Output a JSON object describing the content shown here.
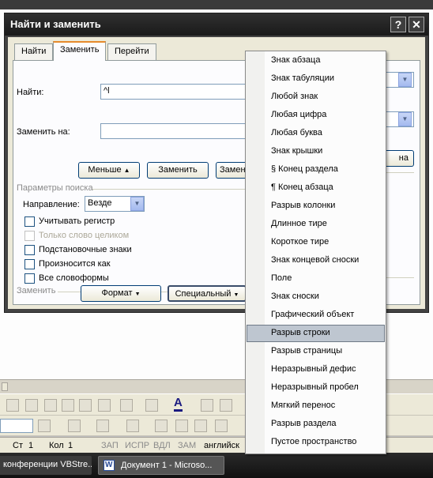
{
  "dialog": {
    "title": "Найти и заменить",
    "help_button": "?",
    "close_button": "✕",
    "tabs": [
      {
        "label": "Найти",
        "active": false
      },
      {
        "label": "Заменить",
        "active": true
      },
      {
        "label": "Перейти",
        "active": false
      }
    ],
    "find_label": "Найти:",
    "find_value": "^l",
    "replace_label": "Заменить на:",
    "replace_value": "",
    "less_button": "Меньше",
    "replace_button": "Заменить",
    "replace_all_button_partial": "Замени",
    "cancel_button_partial": "на",
    "search_params_label": "Параметры поиска",
    "direction_label": "Направление:",
    "direction_value": "Везде",
    "checkboxes": [
      {
        "label": "Учитывать регистр",
        "checked": false,
        "enabled": true
      },
      {
        "label": "Только слово целиком",
        "checked": false,
        "enabled": false
      },
      {
        "label": "Подстановочные знаки",
        "checked": false,
        "enabled": true
      },
      {
        "label": "Произносится как",
        "checked": false,
        "enabled": true
      },
      {
        "label": "Все словоформы",
        "checked": false,
        "enabled": true
      }
    ],
    "replace_section_label": "Заменить",
    "format_button": "Формат",
    "special_button": "Специальный"
  },
  "special_menu": {
    "items": [
      "Знак абзаца",
      "Знак табуляции",
      "Любой знак",
      "Любая цифра",
      "Любая буква",
      "Знак крышки",
      "§ Конец раздела",
      "¶ Конец абзаца",
      "Разрыв колонки",
      "Длинное тире",
      "Короткое тире",
      "Знак концевой сноски",
      "Поле",
      "Знак сноски",
      "Графический объект",
      "Разрыв строки",
      "Разрыв страницы",
      "Неразрывный дефис",
      "Неразрывный пробел",
      "Мягкий перенос",
      "Разрыв раздела",
      "Пустое пространство"
    ],
    "selected": "Разрыв строки"
  },
  "status_bar": {
    "page": "Ст",
    "page_num": "1",
    "column": "Кол",
    "column_num": "1",
    "rec": "ЗАП",
    "trk": "ИСПР",
    "ext": "ВДЛ",
    "ovr": "ЗАМ",
    "language": "английск"
  },
  "taskbar": {
    "item1": "конференции VBStre...",
    "item2": "Документ 1 - Microso..."
  },
  "colors": {
    "title_bar": "#1a1a1a",
    "dialog_face": "#ece9d8",
    "menu_highlight": "#bec6d0",
    "tab_active_accent": "#e68b2c"
  }
}
